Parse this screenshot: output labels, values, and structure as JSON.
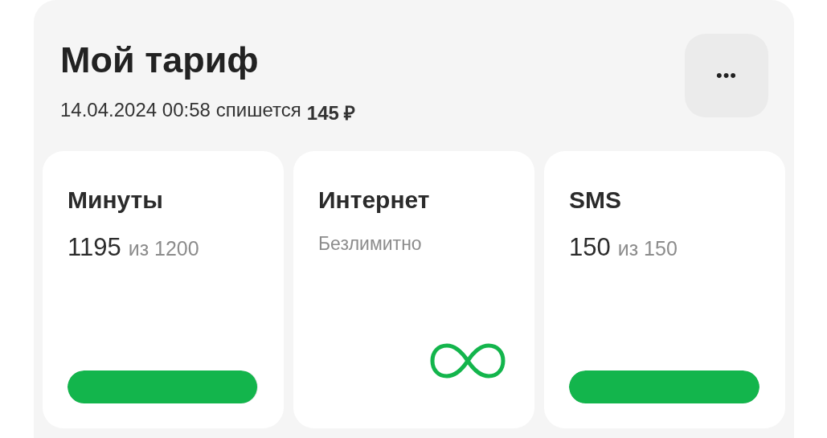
{
  "title": "Мой тариф",
  "charge": {
    "date": "14.04.2024 00:58",
    "text": "спишется",
    "amount": "145 ₽"
  },
  "menu_button": {
    "label": "•••"
  },
  "cards": [
    {
      "kind": "meter",
      "title": "Минуты",
      "used": "1195",
      "of": "из 1200",
      "level": 0.996
    },
    {
      "kind": "unlimited",
      "title": "Интернет",
      "note": "Безлимитно"
    },
    {
      "kind": "meter",
      "title": "SMS",
      "used": "150",
      "of": "из 150",
      "level": 1
    }
  ]
}
